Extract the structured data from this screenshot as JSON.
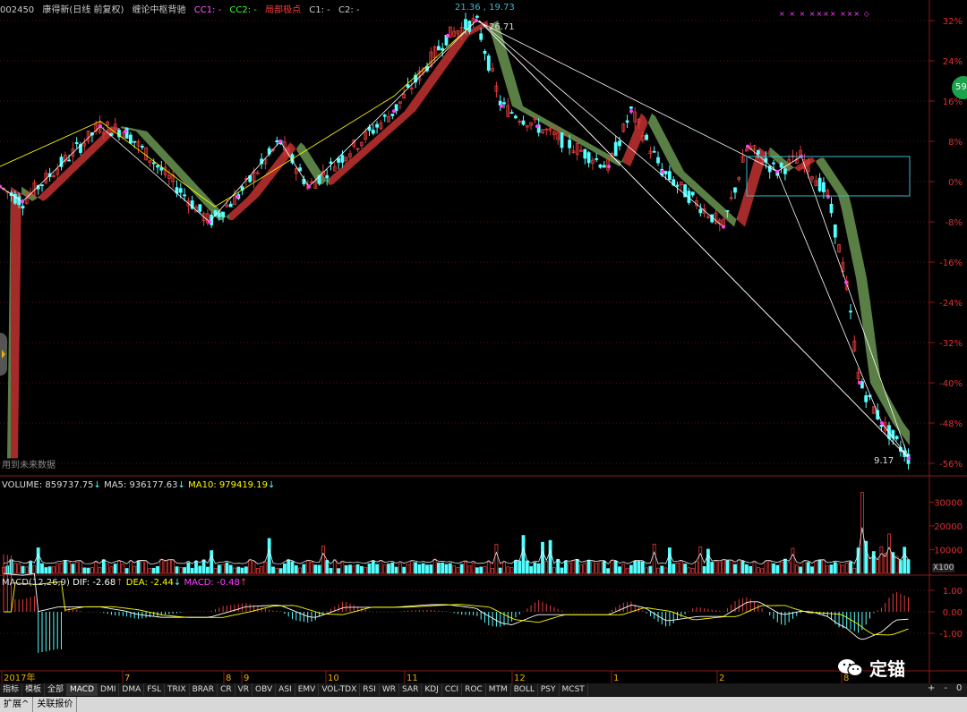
{
  "header": {
    "code": "002450",
    "name": "康得新(日线 前复权)",
    "indicator": "缠论中枢背驰",
    "cc1": "CC1: -",
    "cc2": "CC2: -",
    "local_extreme": "局部极点",
    "c1": "C1: -",
    "c2": "C2: -",
    "right_values": "21.36 , 19.73"
  },
  "price_panel": {
    "high_label": "26.71",
    "low_label": "9.17",
    "hint": "用到未来数据",
    "pct_ticks": [
      "32%",
      "24%",
      "16%",
      "8%",
      "0%",
      "-8%",
      "-16%",
      "-24%",
      "-32%",
      "-40%",
      "-48%",
      "-56%"
    ],
    "top_right_marks": "×  ×   ×  ××××   ×××  ◇"
  },
  "volume_panel": {
    "volume_label": "VOLUME: 859737.75",
    "ma5_label": "MA5: 936177.63",
    "ma10_label": "MA10: 979419.19",
    "ticks": [
      "30000",
      "20000",
      "10000"
    ],
    "unit": "X100"
  },
  "macd_panel": {
    "title": "MACD(12,26,9)",
    "dif_label": "DIF: -2.68",
    "dea_label": "DEA: -2.44",
    "macd_label": "MACD: -0.48",
    "ticks": [
      "1.00",
      "0.00",
      "-1.00"
    ]
  },
  "date_axis": {
    "labels": [
      {
        "text": "2017年"
      },
      {
        "text": "7"
      },
      {
        "text": "8"
      },
      {
        "text": "9"
      },
      {
        "text": "10"
      },
      {
        "text": "11"
      },
      {
        "text": "12"
      },
      {
        "text": "1"
      },
      {
        "text": "2"
      },
      {
        "text": "8"
      }
    ]
  },
  "tabs": [
    "指标",
    "模板",
    "全部",
    "MACD",
    "DMI",
    "DMA",
    "FSL",
    "TRIX",
    "BRAR",
    "CR",
    "VR",
    "OBV",
    "ASI",
    "EMV",
    "VOL-TDX",
    "RSI",
    "WR",
    "SAR",
    "KDJ",
    "CCI",
    "ROC",
    "MTM",
    "BOLL",
    "PSY",
    "MCST"
  ],
  "bottom_tabs": [
    "扩展^",
    "关联报价"
  ],
  "scroll_controls": [
    "+",
    "-",
    "0"
  ],
  "badge": "59",
  "watermark": "定锚",
  "colors": {
    "up": "#e23a3a",
    "down": "#54ffff",
    "band_up": "#a52a2a",
    "band_down": "#5a7f45",
    "dif": "#ffffff",
    "dea": "#ffff00",
    "zigzag": "#ffffff"
  }
}
